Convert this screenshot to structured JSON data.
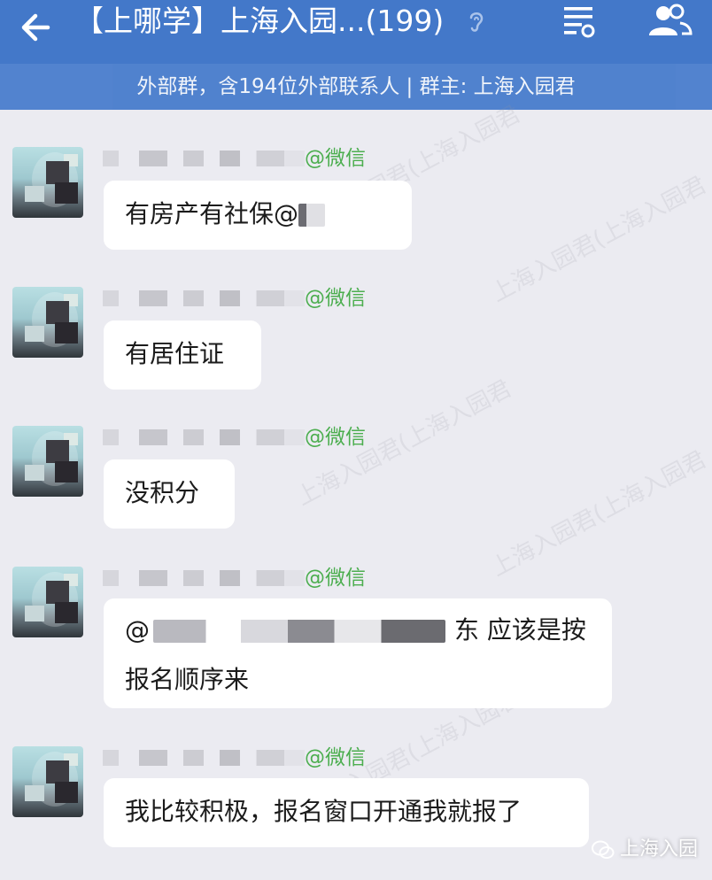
{
  "header": {
    "back_icon": "arrow-left-icon",
    "title": "【上哪学】上海入园...(199)",
    "ear_icon": "ear-icon",
    "menu_icon": "list-settings-icon",
    "members_icon": "group-members-icon",
    "bar_color": "#4378c9"
  },
  "subheader": {
    "text": "外部群，含194位外部联系人 | 群主: 上海入园君"
  },
  "messages": [
    {
      "sender_suffix": "@微信",
      "text": "有房产有社保@"
    },
    {
      "sender_suffix": "@微信",
      "text": "有居住证"
    },
    {
      "sender_suffix": "@微信",
      "text": "没积分"
    },
    {
      "sender_suffix": "@微信",
      "text_prefix": "@",
      "text_mid": "东 应该是按",
      "text_line2": "报名顺序来"
    },
    {
      "sender_suffix": "@微信",
      "text": "我比较积极，报名窗口开通我就报了"
    }
  ],
  "watermark": {
    "text": "上海入园君(上海入园君"
  },
  "brand": {
    "text": "上海入园",
    "icon": "wechat-logo-icon"
  },
  "colors": {
    "wechat_green": "#4cae4f",
    "background": "#ebebf1"
  }
}
